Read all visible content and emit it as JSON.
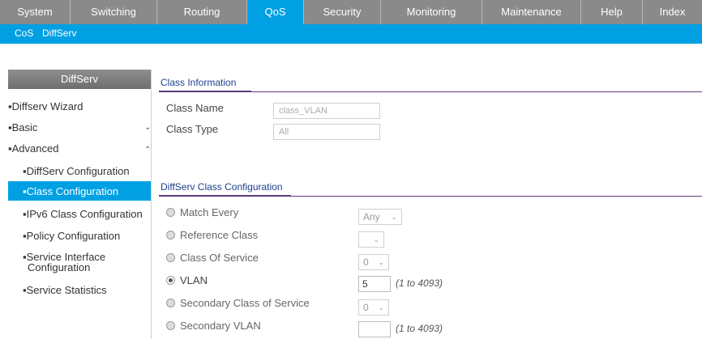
{
  "top_nav": {
    "tabs": [
      {
        "label": "System"
      },
      {
        "label": "Switching"
      },
      {
        "label": "Routing"
      },
      {
        "label": "QoS"
      },
      {
        "label": "Security"
      },
      {
        "label": "Monitoring"
      },
      {
        "label": "Maintenance"
      },
      {
        "label": "Help"
      },
      {
        "label": "Index"
      }
    ],
    "active": "QoS",
    "active_color": "#00a0e3",
    "bar_color": "#8a8a8a"
  },
  "sub_nav": {
    "items": [
      {
        "label": "CoS"
      },
      {
        "label": "DiffServ"
      }
    ],
    "active": "DiffServ"
  },
  "sidebar": {
    "title": "DiffServ",
    "items": [
      {
        "label": "Diffserv Wizard",
        "bullet": "▪"
      },
      {
        "label": "Basic",
        "bullet": "▪",
        "chevron": "chevron-down"
      },
      {
        "label": "Advanced",
        "bullet": "▪",
        "chevron": "chevron-up"
      },
      {
        "label": "DiffServ Configuration",
        "bullet": "▪"
      },
      {
        "label": "Class Configuration",
        "bullet": "▪",
        "selected": true
      },
      {
        "label": "IPv6 Class Configuration",
        "bullet": "▪"
      },
      {
        "label": "Policy Configuration",
        "bullet": "▪"
      },
      {
        "label": "Service Interface",
        "label2": "Configuration",
        "bullet": "▪"
      },
      {
        "label": "Service Statistics",
        "bullet": "▪"
      }
    ]
  },
  "class_info": {
    "title": "Class Information",
    "class_name_label": "Class Name",
    "class_name_value": "class_VLAN",
    "class_type_label": "Class Type",
    "class_type_value": "All"
  },
  "class_config": {
    "title": "DiffServ Class Configuration",
    "rows": [
      {
        "label": "Match Every",
        "control": "select",
        "value": "Any",
        "selected": false
      },
      {
        "label": "Reference Class",
        "control": "select",
        "value": "",
        "selected": false
      },
      {
        "label": "Class Of Service",
        "control": "select",
        "value": "0",
        "selected": false
      },
      {
        "label": "VLAN",
        "control": "input",
        "value": "5",
        "hint": "(1 to 4093)",
        "selected": true
      },
      {
        "label": "Secondary Class of Service",
        "control": "select",
        "value": "0",
        "selected": false
      },
      {
        "label": "Secondary VLAN",
        "control": "input",
        "value": "",
        "hint": "(1 to 4093)",
        "selected": false
      }
    ]
  }
}
